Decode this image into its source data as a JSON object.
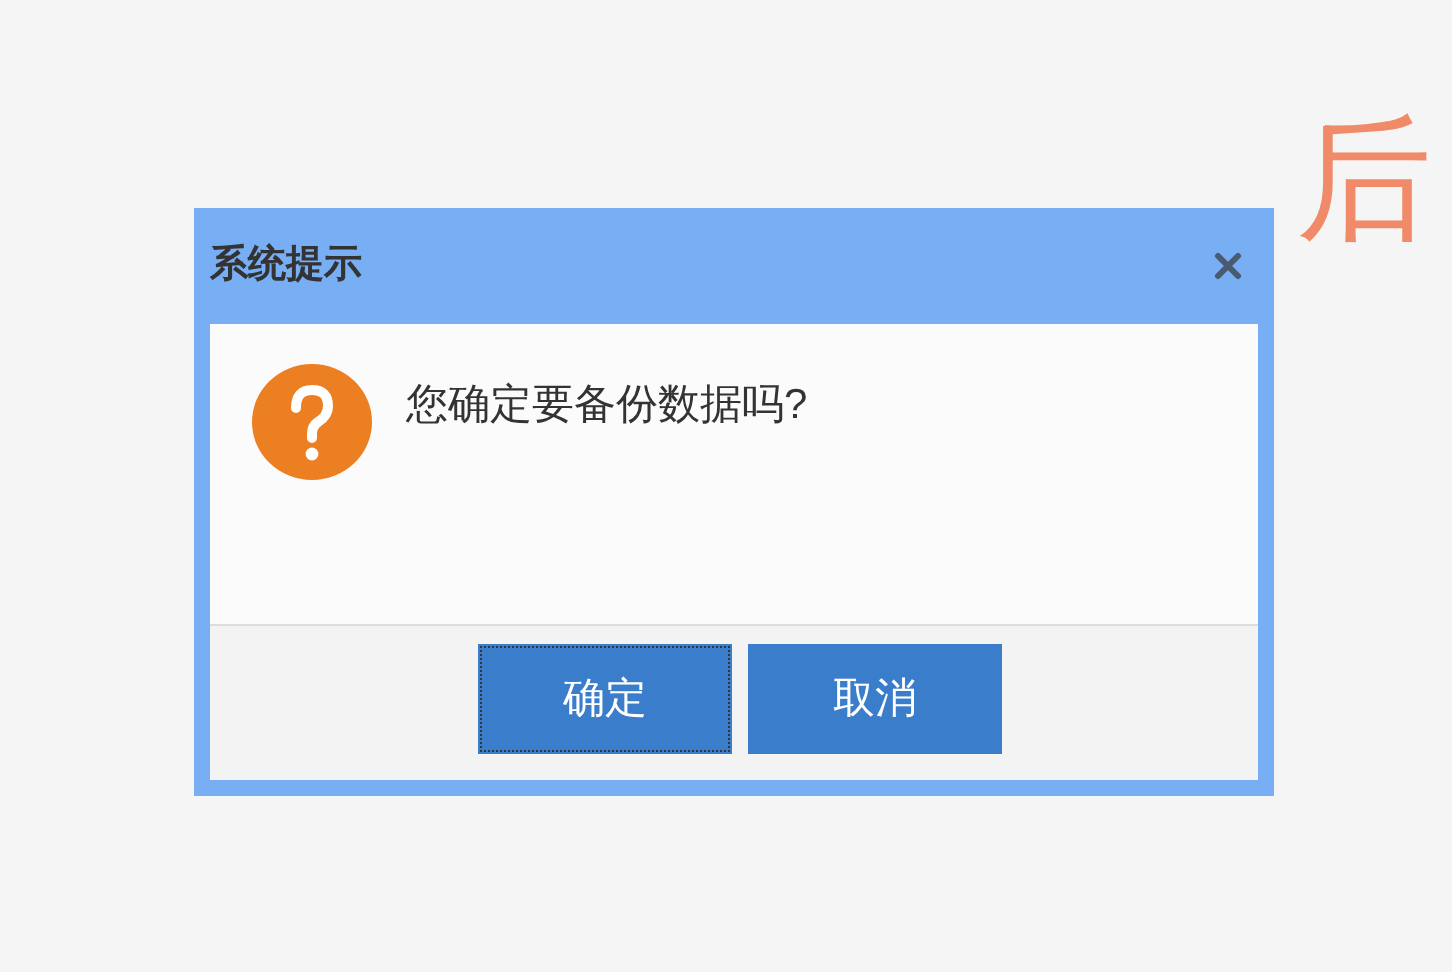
{
  "background_heading": "后",
  "dialog": {
    "title": "系统提示",
    "message": "您确定要备份数据吗?",
    "buttons": [
      {
        "label": "确定",
        "focused": true
      },
      {
        "label": "取消",
        "focused": false
      }
    ]
  }
}
